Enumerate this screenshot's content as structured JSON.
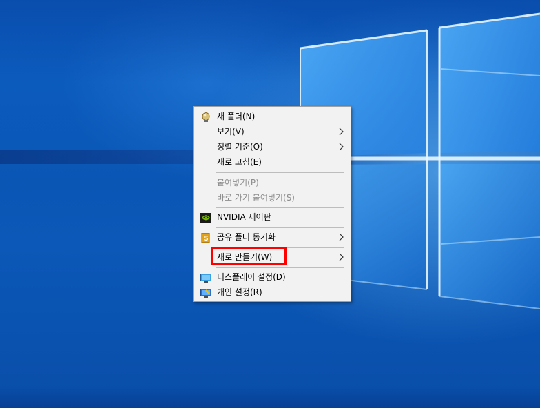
{
  "context_menu": {
    "items": [
      {
        "label": "새 폴더(N)",
        "icon": "new-folder-icon"
      },
      {
        "label": "보기(V)",
        "submenu": true
      },
      {
        "label": "정렬 기준(O)",
        "submenu": true
      },
      {
        "label": "새로 고침(E)"
      },
      {
        "label": "붙여넣기(P)",
        "disabled": true
      },
      {
        "label": "바로 가기 붙여넣기(S)",
        "disabled": true
      },
      {
        "label": "NVIDIA 제어판",
        "icon": "nvidia-icon"
      },
      {
        "label": "공유 폴더 동기화",
        "icon": "sync-icon",
        "submenu": true
      },
      {
        "label": "새로 만들기(W)",
        "submenu": true,
        "highlighted": true
      },
      {
        "label": "디스플레이 설정(D)",
        "icon": "display-icon"
      },
      {
        "label": "개인 설정(R)",
        "icon": "personalize-icon"
      }
    ]
  },
  "colors": {
    "desktop_blue": "#0a56b5",
    "menu_bg": "#f2f2f2",
    "highlight": "#ff0000",
    "disabled_text": "#8c8c8c"
  }
}
